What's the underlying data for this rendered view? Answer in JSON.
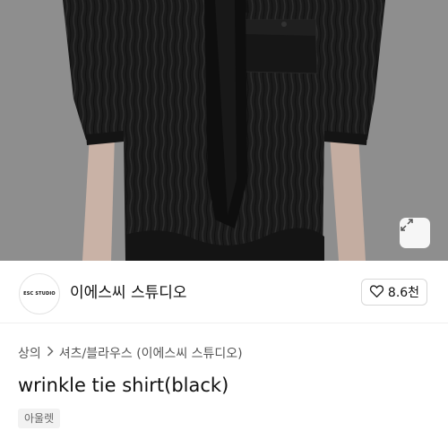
{
  "brand": {
    "logo_text": "ESC STUDIO",
    "name": "이에스씨 스튜디오"
  },
  "like": {
    "icon": "heart-outline-icon",
    "count": "8.6천"
  },
  "photo": {
    "expand_icon": "expand-arrows-icon"
  },
  "breadcrumb": {
    "items": [
      "상의",
      "셔츠/블라우스 (이에스씨 스튜디오)"
    ],
    "separator_icon": "chevron-right-icon"
  },
  "product": {
    "title": "wrinkle tie shirt(black)",
    "tag": "아울렛"
  },
  "colors": {
    "photo_background": "#8c8c8c",
    "shirt": "#1a1a1a",
    "skin": "#c9b2a6"
  }
}
